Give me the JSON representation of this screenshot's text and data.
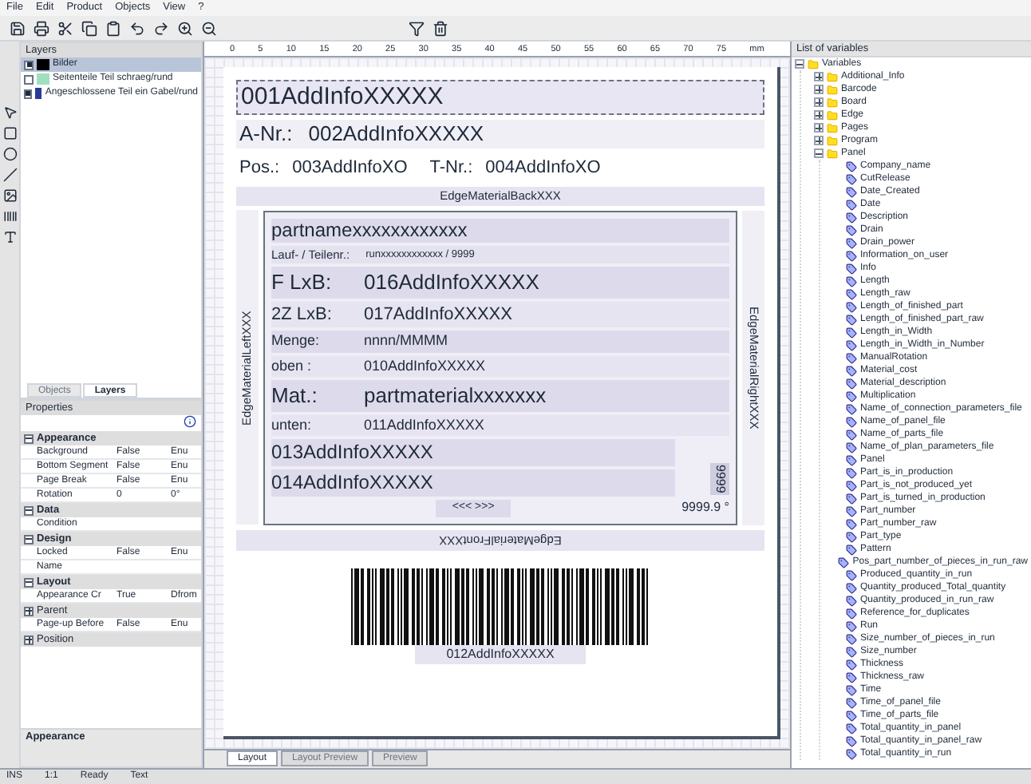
{
  "menu": [
    "File",
    "Edit",
    "Product",
    "Objects",
    "View",
    "?"
  ],
  "layers": {
    "title": "Layers",
    "items": [
      {
        "label": "Bilder",
        "checked": true,
        "color": "#000000",
        "selected": true
      },
      {
        "label": "Seitenteile Teil schraeg/rund",
        "checked": false,
        "color": "#9fe0c0",
        "selected": false
      },
      {
        "label": "Angeschlossene Teil ein Gabel/rund",
        "checked": true,
        "color": "#2a3a9a",
        "selected": false
      }
    ]
  },
  "left_tabs": [
    {
      "label": "Objects",
      "selected": false
    },
    {
      "label": "Layers",
      "selected": true
    }
  ],
  "properties": {
    "title": "Properties",
    "sections": [
      {
        "name": "Appearance",
        "expanded": true,
        "rows": [
          {
            "name": "Background",
            "value": "False",
            "unit": "Enu"
          },
          {
            "name": "Bottom Segment",
            "value": "False",
            "unit": "Enu"
          },
          {
            "name": "Page Break",
            "value": "False",
            "unit": "Enu"
          },
          {
            "name": "Rotation",
            "value": "0",
            "unit": "0°"
          }
        ]
      },
      {
        "name": "Data",
        "expanded": true,
        "rows": [
          {
            "name": "Condition",
            "value": "",
            "unit": ""
          }
        ]
      },
      {
        "name": "Design",
        "expanded": true,
        "rows": [
          {
            "name": "Locked",
            "value": "False",
            "unit": "Enu"
          },
          {
            "name": "Name",
            "value": "",
            "unit": ""
          }
        ]
      },
      {
        "name": "Layout",
        "expanded": true,
        "rows": [
          {
            "name": "Appearance Cr",
            "value": "True",
            "unit": "Dfrom"
          }
        ]
      },
      {
        "name": "Parent",
        "expanded": false,
        "rows": [
          {
            "name": "Page-up Before",
            "value": "False",
            "unit": "Enu"
          }
        ]
      },
      {
        "name": "Position",
        "expanded": false
      }
    ],
    "footer": "Appearance"
  },
  "ruler": [
    "0",
    "5",
    "10",
    "15",
    "20",
    "25",
    "30",
    "35",
    "40",
    "45",
    "50",
    "55",
    "60",
    "65",
    "70",
    "75",
    "mm"
  ],
  "label": {
    "title_field": "001AddInfoXXXXX",
    "a_nr": {
      "caption": "A-Nr.:",
      "value": "002AddInfoXXXXX"
    },
    "pos": {
      "caption": "Pos.:",
      "value": "003AddInfoXO"
    },
    "t_nr": {
      "caption": "T-Nr.:",
      "value": "004AddInfoXO"
    },
    "edge_back": "EdgeMaterialBackXXX",
    "edge_left": "EdgeMaterialLeftXXX",
    "edge_right": "EdgeMaterialRightXXX",
    "edge_front": "EdgeMaterialFrontXXX",
    "part_name": "partnamexxxxxxxxxxxx",
    "run_line": {
      "caption": "Lauf- / Teilenr.:",
      "value": "runxxxxxxxxxxxx / 9999"
    },
    "fields": [
      {
        "caption": "F LxB:",
        "value": "016AddInfoXXXXX",
        "kind": "large"
      },
      {
        "caption": "2Z LxB:",
        "value": "017AddInfoXXXXX",
        "kind": "medium"
      },
      {
        "caption": "Menge:",
        "value": "nnnn/MMMM",
        "kind": "small"
      },
      {
        "caption": "oben :",
        "value": "010AddInfoXXXXX",
        "kind": "small"
      },
      {
        "caption": "Mat.:",
        "value": "partmaterialxxxxxxx",
        "kind": "large"
      },
      {
        "caption": "unten:",
        "value": "011AddInfoXXXXX",
        "kind": "small"
      }
    ],
    "lines": [
      "013AddInfoXXXXX",
      "014AddInfoXXXXX"
    ],
    "pager": "<<< >>>",
    "count_vertical": "9999",
    "angle": "9999.9 °",
    "barcode_text": "012AddInfoXXXXX"
  },
  "bottom_tabs": [
    {
      "label": "Layout",
      "selected": true
    },
    {
      "label": "Layout Preview",
      "selected": false
    },
    {
      "label": "Preview",
      "selected": false
    }
  ],
  "variables": {
    "title": "List of variables",
    "tree": [
      {
        "label": "Variables",
        "kind": "folder",
        "expanded": true,
        "children": [
          {
            "label": "Additional_Info",
            "kind": "folder",
            "expanded": false
          },
          {
            "label": "Barcode",
            "kind": "folder",
            "expanded": false
          },
          {
            "label": "Board",
            "kind": "folder",
            "expanded": false
          },
          {
            "label": "Edge",
            "kind": "folder",
            "expanded": false
          },
          {
            "label": "Pages",
            "kind": "folder",
            "expanded": false
          },
          {
            "label": "Program",
            "kind": "folder",
            "expanded": false
          },
          {
            "label": "Panel",
            "kind": "folder",
            "expanded": true,
            "children": [
              {
                "label": "Company_name",
                "kind": "variable"
              },
              {
                "label": "CutRelease",
                "kind": "variable"
              },
              {
                "label": "Date_Created",
                "kind": "variable"
              },
              {
                "label": "Date",
                "kind": "variable"
              },
              {
                "label": "Description",
                "kind": "variable"
              },
              {
                "label": "Drain",
                "kind": "variable"
              },
              {
                "label": "Drain_power",
                "kind": "variable"
              },
              {
                "label": "Information_on_user",
                "kind": "variable"
              },
              {
                "label": "Info",
                "kind": "variable"
              },
              {
                "label": "Length",
                "kind": "variable"
              },
              {
                "label": "Length_raw",
                "kind": "variable"
              },
              {
                "label": "Length_of_finished_part",
                "kind": "variable"
              },
              {
                "label": "Length_of_finished_part_raw",
                "kind": "variable"
              },
              {
                "label": "Length_in_Width",
                "kind": "variable"
              },
              {
                "label": "Length_in_Width_in_Number",
                "kind": "variable"
              },
              {
                "label": "ManualRotation",
                "kind": "variable"
              },
              {
                "label": "Material_cost",
                "kind": "variable"
              },
              {
                "label": "Material_description",
                "kind": "variable"
              },
              {
                "label": "Multiplication",
                "kind": "variable"
              },
              {
                "label": "Name_of_connection_parameters_file",
                "kind": "variable"
              },
              {
                "label": "Name_of_panel_file",
                "kind": "variable"
              },
              {
                "label": "Name_of_parts_file",
                "kind": "variable"
              },
              {
                "label": "Name_of_plan_parameters_file",
                "kind": "variable"
              },
              {
                "label": "Panel",
                "kind": "variable"
              },
              {
                "label": "Part_is_in_production",
                "kind": "variable"
              },
              {
                "label": "Part_is_not_produced_yet",
                "kind": "variable"
              },
              {
                "label": "Part_is_turned_in_production",
                "kind": "variable"
              },
              {
                "label": "Part_number",
                "kind": "variable"
              },
              {
                "label": "Part_number_raw",
                "kind": "variable"
              },
              {
                "label": "Part_type",
                "kind": "variable"
              },
              {
                "label": "Pattern",
                "kind": "variable"
              },
              {
                "label": "Pos_part_number_of_pieces_in_run_raw",
                "kind": "variable"
              },
              {
                "label": "Produced_quantity_in_run",
                "kind": "variable"
              },
              {
                "label": "Quantity_produced_Total_quantity",
                "kind": "variable"
              },
              {
                "label": "Quantity_produced_in_run_raw",
                "kind": "variable"
              },
              {
                "label": "Reference_for_duplicates",
                "kind": "variable"
              },
              {
                "label": "Run",
                "kind": "variable"
              },
              {
                "label": "Size_number_of_pieces_in_run",
                "kind": "variable"
              },
              {
                "label": "Size_number",
                "kind": "variable"
              },
              {
                "label": "Thickness",
                "kind": "variable"
              },
              {
                "label": "Thickness_raw",
                "kind": "variable"
              },
              {
                "label": "Time",
                "kind": "variable"
              },
              {
                "label": "Time_of_panel_file",
                "kind": "variable"
              },
              {
                "label": "Time_of_parts_file",
                "kind": "variable"
              },
              {
                "label": "Total_quantity_in_panel",
                "kind": "variable"
              },
              {
                "label": "Total_quantity_in_panel_raw",
                "kind": "variable"
              },
              {
                "label": "Total_quantity_in_run",
                "kind": "variable"
              }
            ]
          }
        ]
      }
    ]
  },
  "status_bar": [
    "INS",
    "1:1",
    "Ready",
    "Text"
  ]
}
